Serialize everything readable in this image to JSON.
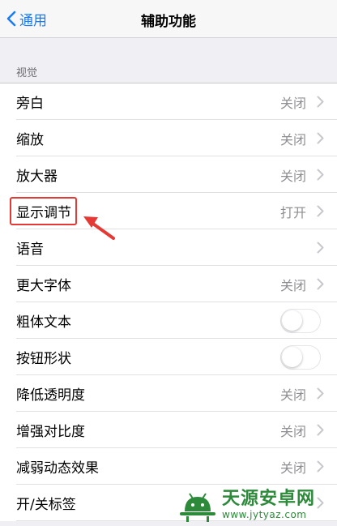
{
  "nav": {
    "back_label": "通用",
    "title": "辅助功能"
  },
  "section": {
    "header": "视觉"
  },
  "rows": [
    {
      "label": "旁白",
      "value": "关闭",
      "control": "chevron"
    },
    {
      "label": "缩放",
      "value": "关闭",
      "control": "chevron"
    },
    {
      "label": "放大器",
      "value": "关闭",
      "control": "chevron"
    },
    {
      "label": "显示调节",
      "value": "打开",
      "control": "chevron"
    },
    {
      "label": "语音",
      "value": "",
      "control": "chevron"
    },
    {
      "label": "更大字体",
      "value": "关闭",
      "control": "chevron"
    },
    {
      "label": "粗体文本",
      "value": "",
      "control": "toggle",
      "on": false
    },
    {
      "label": "按钮形状",
      "value": "",
      "control": "toggle",
      "on": false
    },
    {
      "label": "降低透明度",
      "value": "关闭",
      "control": "chevron"
    },
    {
      "label": "增强对比度",
      "value": "关闭",
      "control": "chevron"
    },
    {
      "label": "减弱动态效果",
      "value": "关闭",
      "control": "chevron"
    },
    {
      "label": "开/关标签",
      "value": "",
      "control": "chevron"
    }
  ],
  "annotation": {
    "color": "#e53935"
  },
  "watermark": {
    "title": "天源安卓网",
    "url": "www.jytyaz.com"
  },
  "colors": {
    "accent": "#1a7cf5",
    "background": "#efeff4",
    "secondary_text": "#8e8e93",
    "watermark": "#2d8a3a"
  }
}
